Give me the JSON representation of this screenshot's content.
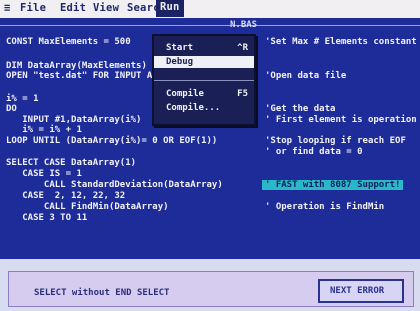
{
  "menu": {
    "system": "≡",
    "items": [
      "File",
      "Edit",
      "View",
      "Search",
      "Run"
    ]
  },
  "editor": {
    "title": "N.BAS",
    "code_lines": [
      "CONST MaxElements = 500",
      "DIM DataArray(MaxElements)",
      "OPEN \"test.dat\" FOR INPUT A",
      "i% = 1",
      "DO",
      "   INPUT #1,DataArray(i%)",
      "   i% = i% + 1",
      "LOOP UNTIL (DataArray(i%)= 0 OR EOF(1))",
      "SELECT CASE DataArray(1)",
      "   CASE IS = 1",
      "       CALL StandardDeviation(DataArray)",
      "   CASE  2, 12, 22, 32",
      "       CALL FindMin(DataArray)",
      "   CASE 3 TO 11"
    ],
    "comments": [
      "'Set Max # Elements constant",
      "'Open data file",
      "'Get the data",
      "' First element is operation",
      "'Stop looping if reach EOF",
      "' or find data = 0",
      "' FAST with 8087 Support!",
      "' Operation is FindMin"
    ]
  },
  "run_menu": {
    "items": [
      {
        "label": "Start",
        "shortcut": "^R"
      },
      {
        "label": "Debug",
        "shortcut": ""
      },
      {
        "label": "Compile",
        "shortcut": "F5"
      },
      {
        "label": "Compile...",
        "shortcut": ""
      }
    ]
  },
  "status": {
    "message": "SELECT without END SELECT",
    "button": "NEXT ERROR"
  }
}
